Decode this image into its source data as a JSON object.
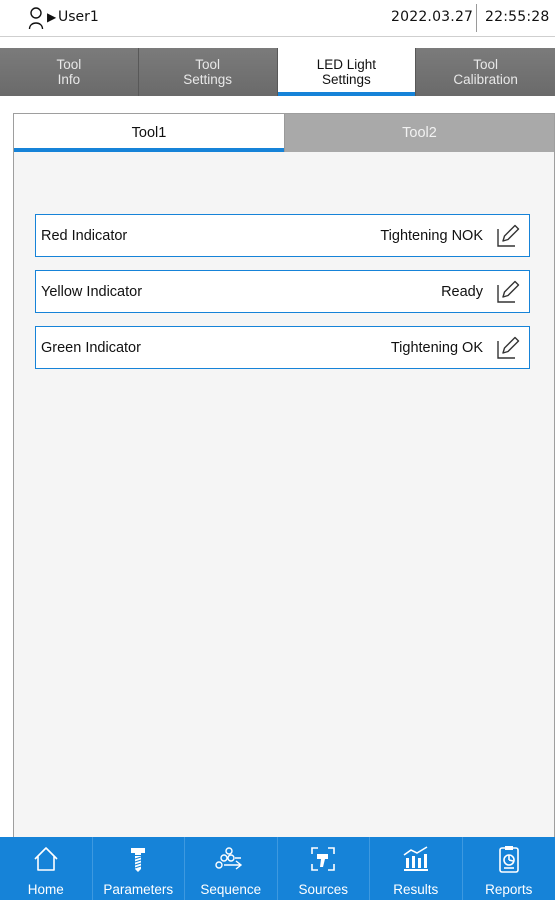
{
  "status": {
    "user": "User1",
    "date": "2022.03.27",
    "time": "22:55:28"
  },
  "top_tabs": [
    {
      "label": "Tool\nInfo",
      "active": false
    },
    {
      "label": "Tool\nSettings",
      "active": false
    },
    {
      "label": "LED Light\nSettings",
      "active": true
    },
    {
      "label": "Tool\nCalibration",
      "active": false
    }
  ],
  "sub_tabs": [
    {
      "label": "Tool1",
      "active": true
    },
    {
      "label": "Tool2",
      "active": false
    }
  ],
  "indicators": [
    {
      "label": "Red Indicator",
      "value": "Tightening NOK"
    },
    {
      "label": "Yellow Indicator",
      "value": "Ready"
    },
    {
      "label": "Green Indicator",
      "value": "Tightening OK"
    }
  ],
  "bottom_nav": [
    {
      "label": "Home",
      "icon": "home-icon"
    },
    {
      "label": "Parameters",
      "icon": "screw-icon"
    },
    {
      "label": "Sequence",
      "icon": "sequence-icon"
    },
    {
      "label": "Sources",
      "icon": "sources-icon"
    },
    {
      "label": "Results",
      "icon": "results-icon"
    },
    {
      "label": "Reports",
      "icon": "reports-icon"
    }
  ],
  "colors": {
    "accent": "#1683d8",
    "tab_bg": "#6d6d6d",
    "inactive_subtab": "#a9a9a9"
  }
}
